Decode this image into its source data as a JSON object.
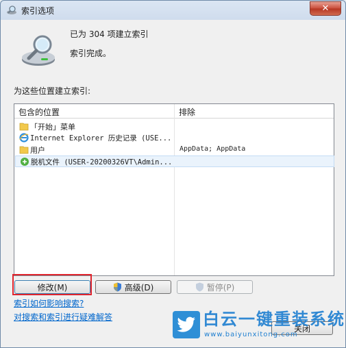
{
  "window": {
    "title": "索引选项",
    "close_glyph": "✕"
  },
  "summary": {
    "count_text": "已为 304 项建立索引",
    "status_text": "索引完成。"
  },
  "section_label": "为这些位置建立索引:",
  "list": {
    "columns": [
      "包含的位置",
      "排除"
    ],
    "rows": [
      {
        "icon": "folder-icon",
        "name": "「开始」菜单",
        "exclude": ""
      },
      {
        "icon": "internet-explorer-icon",
        "name": "Internet Explorer 历史记录 (USE...",
        "exclude": ""
      },
      {
        "icon": "folder-icon",
        "name": "用户",
        "exclude": "AppData; AppData"
      },
      {
        "icon": "offline-files-icon",
        "name": "脱机文件 (USER-20200326VT\\Admin...",
        "exclude": ""
      }
    ]
  },
  "buttons": {
    "modify": "修改(M)",
    "advanced": "高级(D)",
    "pause": "暂停(P)",
    "close": "关闭"
  },
  "links": {
    "affect_search": "索引如何影响搜索?",
    "troubleshoot": "对搜索和索引进行疑难解答"
  },
  "watermark": {
    "title": "白云一键重装系统",
    "url": "www.baiyunxitong.com"
  },
  "colors": {
    "accent": "#3c7fb1",
    "link": "#0066cc",
    "highlight": "#e0242d"
  }
}
